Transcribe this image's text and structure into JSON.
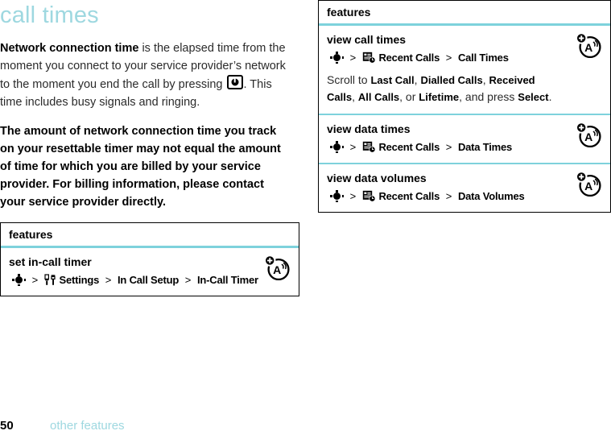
{
  "page": {
    "chapter_title": "call times",
    "footer": {
      "page_number": "50",
      "section_name": "other features"
    },
    "accent_color": "#7ed2dc",
    "title_color": "#9ed8e0"
  },
  "body": {
    "paragraph1": {
      "lead": "Network connection time",
      "text_before_key": " is the elapsed time from the moment you connect to your service provider’s network to the moment you end the call by pressing ",
      "key_icon": "power-end-key-icon",
      "text_after_key": ". This time includes busy signals and ringing."
    },
    "paragraph2": "The amount of network connection time you track on your resettable timer may not equal the amount of time for which you are billed by your service provider. For billing information, please contact your service provider directly."
  },
  "left_table": {
    "header": "features",
    "rows": [
      {
        "title": "set in-call timer",
        "nav_icon": "nav-key-icon",
        "sep1": ">",
        "menu_icon": "settings-tools-icon",
        "step1": "Settings",
        "sep2": ">",
        "step2": "In Call Setup",
        "sep3": ">",
        "step3": "In-Call Timer",
        "badge_icon": "network-a-badge-icon"
      }
    ]
  },
  "right_table": {
    "header": "features",
    "rows": [
      {
        "title": "view call times",
        "nav_icon": "nav-key-icon",
        "sep1": ">",
        "menu_icon": "recent-calls-icon",
        "step1": "Recent Calls",
        "sep2": ">",
        "step2": "Call Times",
        "badge_icon": "network-a-badge-icon",
        "note": {
          "t1": "Scroll to ",
          "b1": "Last Call",
          "t2": ", ",
          "b2": "Dialled Calls",
          "t3": ", ",
          "b3": "Received Calls",
          "t4": ", ",
          "b4": "All Calls",
          "t5": ", or ",
          "b5": "Lifetime",
          "t6": ", and press ",
          "b6": "Select",
          "t7": "."
        }
      },
      {
        "title": "view data times",
        "nav_icon": "nav-key-icon",
        "sep1": ">",
        "menu_icon": "recent-calls-icon",
        "step1": "Recent Calls",
        "sep2": ">",
        "step2": "Data Times",
        "badge_icon": "network-a-badge-icon"
      },
      {
        "title": "view data volumes",
        "nav_icon": "nav-key-icon",
        "sep1": ">",
        "menu_icon": "recent-calls-icon",
        "step1": "Recent Calls",
        "sep2": ">",
        "step2": "Data Volumes",
        "badge_icon": "network-a-badge-icon"
      }
    ]
  }
}
